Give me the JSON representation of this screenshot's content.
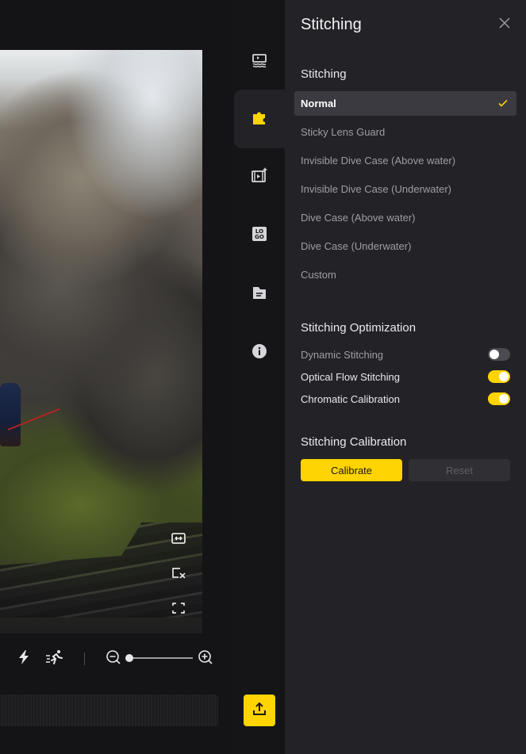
{
  "panel": {
    "title": "Stitching",
    "stitching_section": {
      "heading": "Stitching",
      "options": [
        {
          "label": "Normal",
          "selected": true
        },
        {
          "label": "Sticky Lens Guard",
          "selected": false
        },
        {
          "label": "Invisible Dive Case (Above water)",
          "selected": false
        },
        {
          "label": "Invisible Dive Case (Underwater)",
          "selected": false
        },
        {
          "label": "Dive Case (Above water)",
          "selected": false
        },
        {
          "label": "Dive Case (Underwater)",
          "selected": false
        },
        {
          "label": "Custom",
          "selected": false
        }
      ]
    },
    "optimization_section": {
      "heading": "Stitching Optimization",
      "toggles": [
        {
          "label": "Dynamic Stitching",
          "on": false
        },
        {
          "label": "Optical Flow Stitching",
          "on": true
        },
        {
          "label": "Chromatic Calibration",
          "on": true
        }
      ]
    },
    "calibration_section": {
      "heading": "Stitching Calibration",
      "calibrate_label": "Calibrate",
      "reset_label": "Reset"
    }
  },
  "rail": {
    "items": [
      {
        "icon": "underwater-icon",
        "active": false
      },
      {
        "icon": "puzzle-icon",
        "active": true
      },
      {
        "icon": "video-effects-icon",
        "active": false
      },
      {
        "icon": "logo-icon",
        "active": false
      },
      {
        "icon": "clipboard-icon",
        "active": false
      },
      {
        "icon": "info-icon",
        "active": false
      }
    ]
  },
  "preview": {
    "overlay_buttons": [
      "fit-width-icon",
      "crop-off-icon",
      "fullscreen-icon"
    ]
  },
  "toolbar": {
    "icons": [
      "flash-icon",
      "running-speed-icon",
      "zoom-out-icon",
      "zoom-in-icon"
    ],
    "zoom_level": 0.05
  },
  "colors": {
    "accent": "#ffd400",
    "panel_bg": "#232327",
    "app_bg": "#151518"
  }
}
